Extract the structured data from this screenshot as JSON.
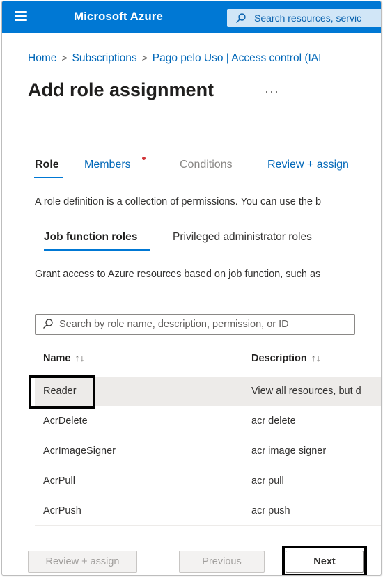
{
  "topbar": {
    "brand": "Microsoft Azure",
    "search_placeholder": "Search resources, servic",
    "bg_color": "#0078d4"
  },
  "breadcrumb": {
    "items": [
      "Home",
      "Subscriptions",
      "Pago pelo Uso | Access control (IAI"
    ],
    "separator": ">"
  },
  "page": {
    "title": "Add role assignment",
    "more": "···"
  },
  "tabs": [
    {
      "label": "Role",
      "state": "active"
    },
    {
      "label": "Members",
      "state": "link",
      "badge": "red-dot"
    },
    {
      "label": "Conditions",
      "state": "disabled"
    },
    {
      "label": "Review + assign",
      "state": "link"
    }
  ],
  "description": "A role definition is a collection of permissions. You can use the b",
  "role_tabs": [
    {
      "label": "Job function roles",
      "state": "active"
    },
    {
      "label": "Privileged administrator roles",
      "state": "normal"
    }
  ],
  "grant_text": "Grant access to Azure resources based on job function, such as",
  "role_search": {
    "placeholder": "Search by role name, description, permission, or ID"
  },
  "table": {
    "columns": [
      {
        "label": "Name",
        "sort": "↑↓"
      },
      {
        "label": "Description",
        "sort": "↑↓"
      }
    ],
    "rows": [
      {
        "name": "Reader",
        "description": "View all resources, but d",
        "selected": true
      },
      {
        "name": "AcrDelete",
        "description": "acr delete"
      },
      {
        "name": "AcrImageSigner",
        "description": "acr image signer"
      },
      {
        "name": "AcrPull",
        "description": "acr pull"
      },
      {
        "name": "AcrPush",
        "description": "acr push"
      }
    ]
  },
  "footer": {
    "review_label": "Review + assign",
    "previous_label": "Previous",
    "next_label": "Next"
  }
}
